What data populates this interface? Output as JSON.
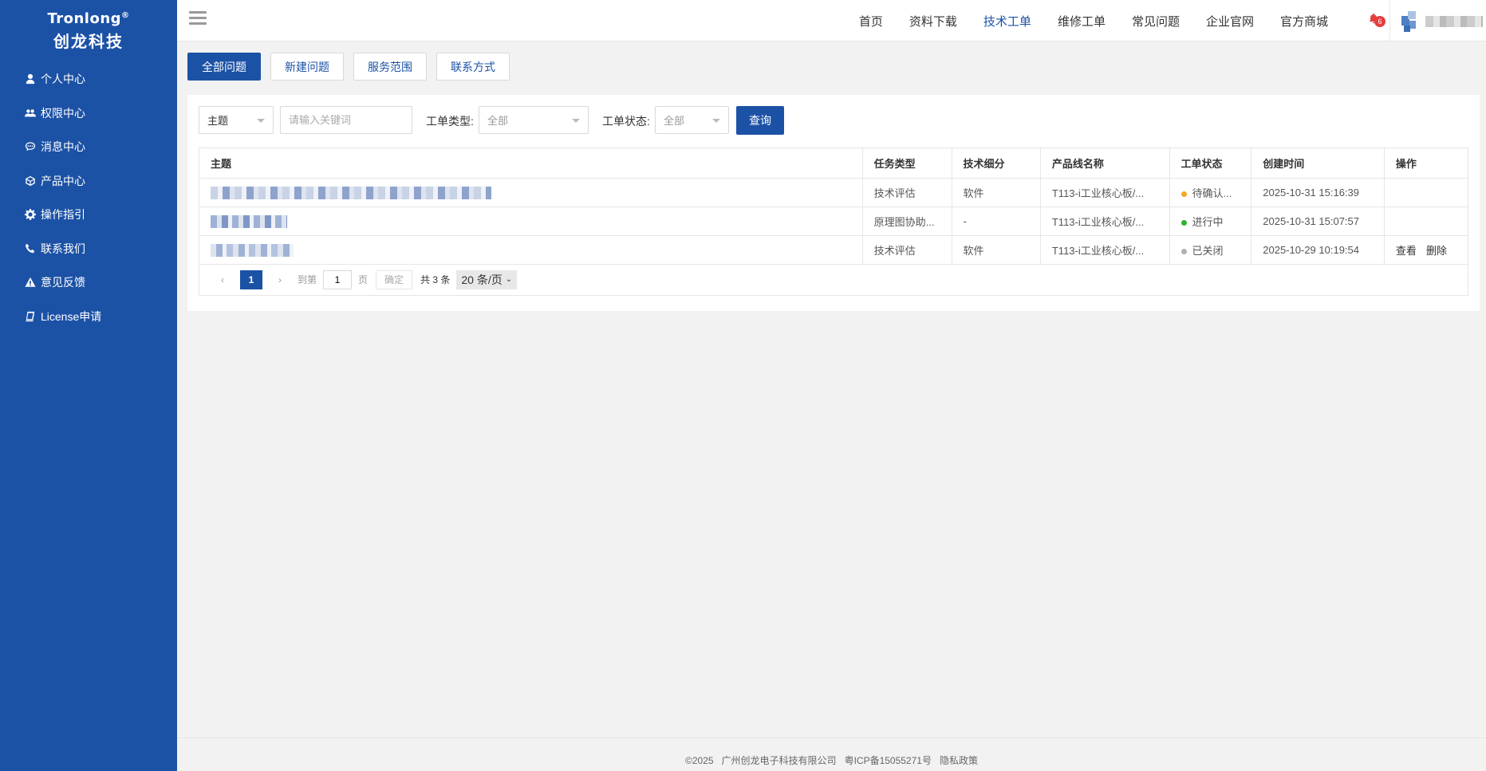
{
  "sidebar": {
    "brand_en": "Tronlong",
    "brand_reg": "®",
    "brand_cn": "创龙科技",
    "items": [
      {
        "label": "个人中心",
        "icon": "user-icon"
      },
      {
        "label": "权限中心",
        "icon": "users-icon"
      },
      {
        "label": "消息中心",
        "icon": "chat-icon"
      },
      {
        "label": "产品中心",
        "icon": "cube-icon"
      },
      {
        "label": "操作指引",
        "icon": "gear-icon"
      },
      {
        "label": "联系我们",
        "icon": "phone-icon"
      },
      {
        "label": "意见反馈",
        "icon": "warning-icon"
      },
      {
        "label": "License申请",
        "icon": "book-icon"
      }
    ]
  },
  "header": {
    "nav": [
      "首页",
      "资料下载",
      "技术工单",
      "维修工单",
      "常见问题",
      "企业官网",
      "官方商城"
    ],
    "active_nav": "技术工单",
    "notification_count": "6"
  },
  "tabs": [
    "全部问题",
    "新建问题",
    "服务范围",
    "联系方式"
  ],
  "active_tab": "全部问题",
  "filters": {
    "field_select": "主题",
    "keyword_placeholder": "请输入关键词",
    "type_label": "工单类型:",
    "type_value": "全部",
    "status_label": "工单状态:",
    "status_value": "全部",
    "query_button": "查询"
  },
  "table": {
    "headers": [
      "主题",
      "任务类型",
      "技术细分",
      "产品线名称",
      "工单状态",
      "创建时间",
      "操作"
    ],
    "rows": [
      {
        "type": "技术评估",
        "sub": "软件",
        "product": "T113-i工业核心板/...",
        "status": "待确认...",
        "status_color": "#f5a623",
        "time": "2025-10-31 15:16:39",
        "actions": []
      },
      {
        "type": "原理图协助...",
        "sub": "-",
        "product": "T113-i工业核心板/...",
        "status": "进行中",
        "status_color": "#2bb32b",
        "time": "2025-10-31 15:07:57",
        "actions": []
      },
      {
        "type": "技术评估",
        "sub": "软件",
        "product": "T113-i工业核心板/...",
        "status": "已关闭",
        "status_color": "#b0b0b0",
        "time": "2025-10-29 10:19:54",
        "actions": [
          "查看",
          "删除"
        ]
      }
    ]
  },
  "pagination": {
    "current": "1",
    "goto_label": "到第",
    "goto_value": "1",
    "page_unit": "页",
    "confirm": "确定",
    "total": "共 3 条",
    "page_size": "20 条/页"
  },
  "footer": {
    "copyright": "©2025",
    "company": "广州创龙电子科技有限公司",
    "icp": "粤ICP备15055271号",
    "privacy": "隐私政策"
  },
  "colors": {
    "brand": "#1c52a6"
  }
}
